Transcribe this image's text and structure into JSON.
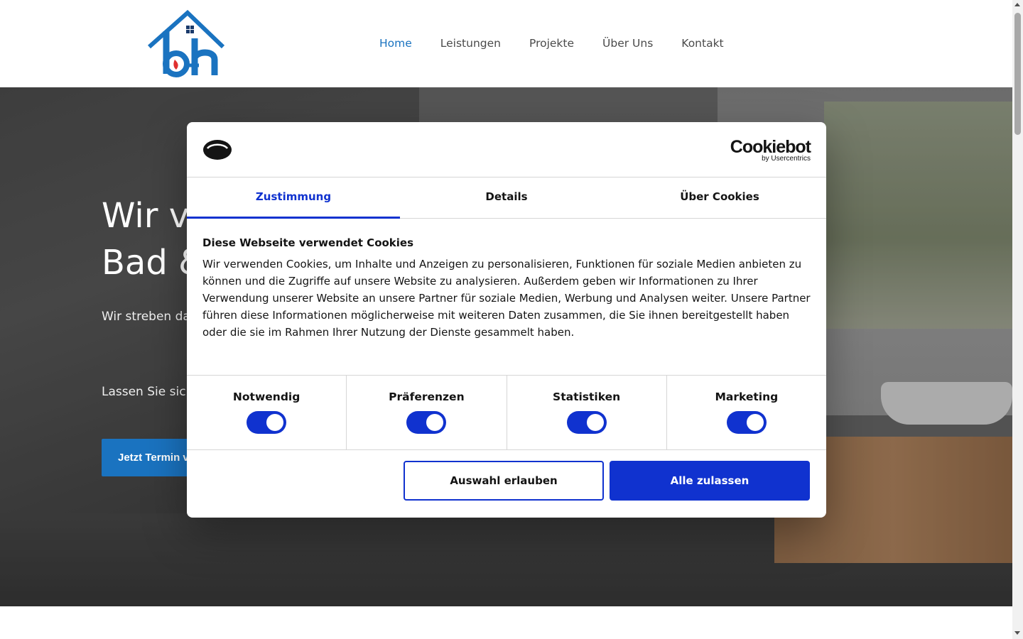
{
  "nav": {
    "items": [
      {
        "label": "Home",
        "active": true
      },
      {
        "label": "Leistungen",
        "active": false
      },
      {
        "label": "Projekte",
        "active": false
      },
      {
        "label": "Über Uns",
        "active": false
      },
      {
        "label": "Kontakt",
        "active": false
      }
    ],
    "logo_icon": "bh-house-logo-icon"
  },
  "hero": {
    "title": "Wir ve\nBad &",
    "text": "Wir streben da schaffen, die S mit Blick auf u",
    "text2": "Lassen Sie sic",
    "cta_label": "Jetzt Termin v"
  },
  "cookie": {
    "brand": "Cookiebot",
    "brand_by": "by Usercentrics",
    "tabs": [
      "Zustimmung",
      "Details",
      "Über Cookies"
    ],
    "active_tab": "Zustimmung",
    "heading": "Diese Webseite verwendet Cookies",
    "body": "Wir verwenden Cookies, um Inhalte und Anzeigen zu personalisieren, Funktionen für soziale Medien anbieten zu können und die Zugriffe auf unsere Website zu analysieren. Außerdem geben wir Informationen zu Ihrer Verwendung unserer Website an unsere Partner für soziale Medien, Werbung und Analysen weiter. Unsere Partner führen diese Informationen möglicherweise mit weiteren Daten zusammen, die Sie ihnen bereitgestellt haben oder die sie im Rahmen Ihrer Nutzung der Dienste gesammelt haben.",
    "categories": [
      {
        "label": "Notwendig",
        "on": true
      },
      {
        "label": "Präferenzen",
        "on": true
      },
      {
        "label": "Statistiken",
        "on": true
      },
      {
        "label": "Marketing",
        "on": true
      }
    ],
    "btn_selection": "Auswahl erlauben",
    "btn_all": "Alle zulassen"
  },
  "colors": {
    "nav_active": "#1a73c0",
    "cookie_accent": "#1032cf",
    "cta_bg": "#1a73c0"
  }
}
